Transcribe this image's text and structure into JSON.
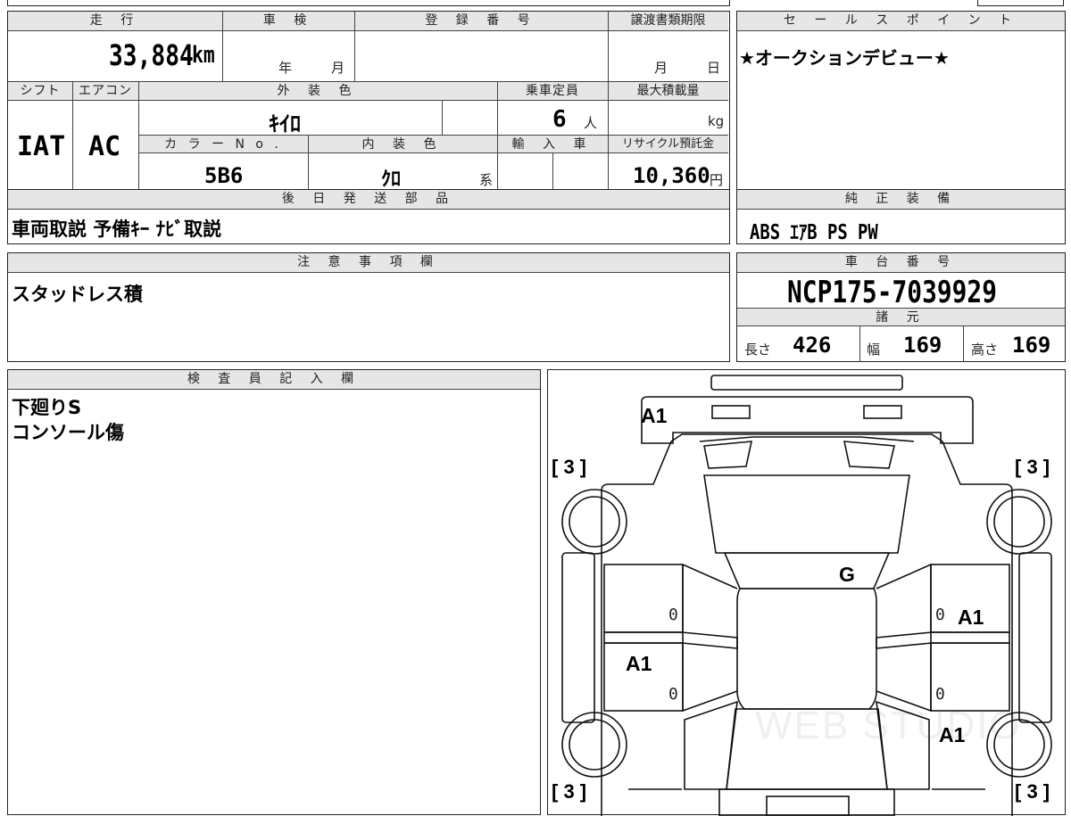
{
  "vehicle": {
    "mileage_label": "走 行",
    "mileage_value": "33,884",
    "mileage_unit": "km",
    "inspection_label": "車 検",
    "inspection_year_unit": "年",
    "inspection_month_unit": "月",
    "registration_label": "登 録 番 号",
    "transfer_deadline_label": "譲渡書類期限",
    "transfer_month_unit": "月",
    "transfer_day_unit": "日",
    "shift_label": "シフト",
    "shift_value": "IAT",
    "aircon_label": "エアコン",
    "aircon_value": "AC",
    "exterior_color_label": "外 装 色",
    "exterior_color_value": "ｷｲﾛ",
    "capacity_label": "乗車定員",
    "capacity_value": "6",
    "capacity_unit": "人",
    "max_load_label": "最大積載量",
    "max_load_unit": "kg",
    "color_no_label": "カ ラ ー N o .",
    "color_no_value": "5B6",
    "interior_color_label": "内 装 色",
    "interior_color_value": "ｸﾛ",
    "interior_color_suffix": "系",
    "import_label": "輸 入 車",
    "recycle_label": "リサイクル預託金",
    "recycle_value": "10,360",
    "recycle_unit": "円"
  },
  "sales_point": {
    "label": "セ ー ル ス ポ イ ン ト",
    "text": "★オークションデビュー★"
  },
  "later_parts": {
    "label": "後 日 発 送 部 品",
    "text": "車両取説 予備ｷｰ ﾅﾋﾞ取説"
  },
  "genuine_equipment": {
    "label": "純 正 装 備",
    "text": "ABS ｴｱB PS PW"
  },
  "notes": {
    "label": "注 意 事 項 欄",
    "text": "スタッドレス積"
  },
  "chassis": {
    "label": "車 台 番 号",
    "value": "NCP175-7039929"
  },
  "specs": {
    "label": "諸 元",
    "length_label": "長さ",
    "length_value": "426",
    "width_label": "幅",
    "width_value": "169",
    "height_label": "高さ",
    "height_value": "169"
  },
  "inspector": {
    "label": "検 査 員 記 入 欄",
    "line1": "下廻りS",
    "line2": "コンソール傷"
  },
  "diagram": {
    "tire_fl": "[ 3 ]",
    "tire_fr": "[ 3 ]",
    "tire_rl": "[ 3 ]",
    "tire_rr": "[ 3 ]",
    "front_bumper": "A1",
    "windshield": "G",
    "left_front_door": "0",
    "right_front_door": "0",
    "right_front_door_mark": "A1",
    "left_rear_door_mark": "A1",
    "left_rear_door": "0",
    "right_rear_door": "0",
    "right_rear_quarter": "A1",
    "watermark": "WEB STUDIO"
  }
}
